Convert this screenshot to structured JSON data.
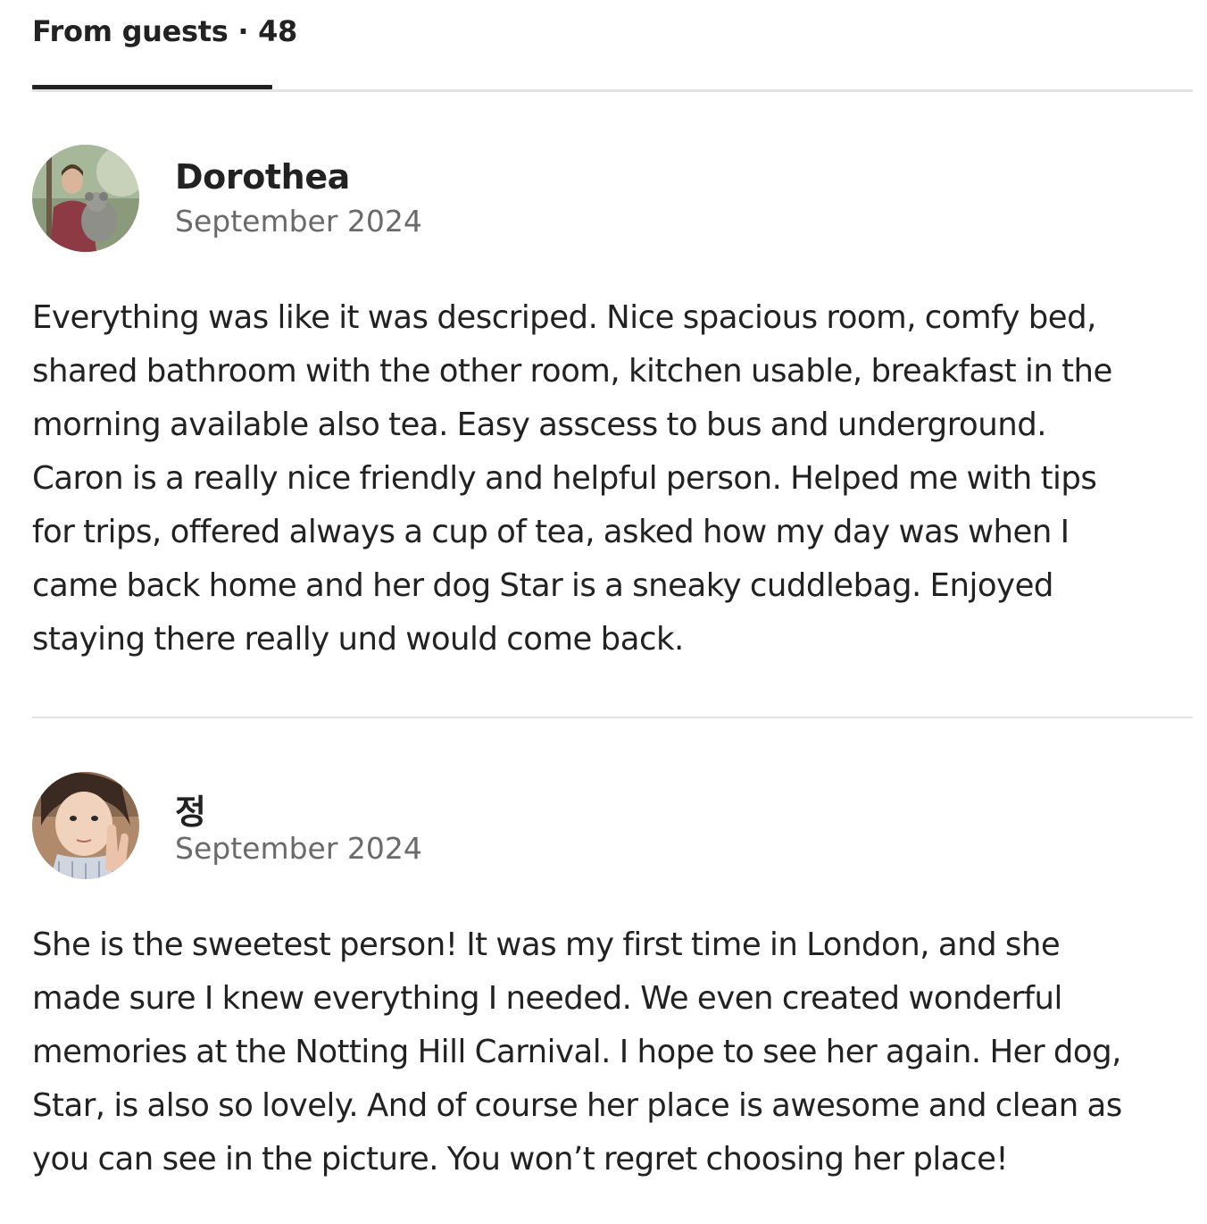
{
  "tabs": {
    "guests_label": "From guests · 48"
  },
  "reviews": [
    {
      "name": "Dorothea",
      "date": "September 2024",
      "lines": [
        "Everything was like it was descriped. Nice spacious room, comfy bed,",
        "shared bathroom with the other room, kitchen usable, breakfast in the",
        "morning available also tea. Easy asscess to bus and underground.",
        "Caron is a really nice friendly and helpful person. Helped me with tips",
        "for trips, offered always a cup of tea, asked how my day was when I",
        "came back home and her dog Star is a sneaky cuddlebag. Enjoyed",
        "staying there really und would come back."
      ]
    },
    {
      "name": "정",
      "date": "September 2024",
      "lines": [
        "She is the sweetest person! It was my first time in London, and she",
        "made sure I knew everything I needed. We even created wonderful",
        "memories at the Notting Hill Carnival. I hope to see her again. Her dog,",
        "Star, is also so lovely. And of course her place is awesome and clean as",
        "you can see in the picture. You won’t regret choosing her place!"
      ]
    }
  ],
  "colors": {
    "text": "#222222",
    "muted": "#6a6a6a",
    "divider": "#e2e2e2"
  }
}
